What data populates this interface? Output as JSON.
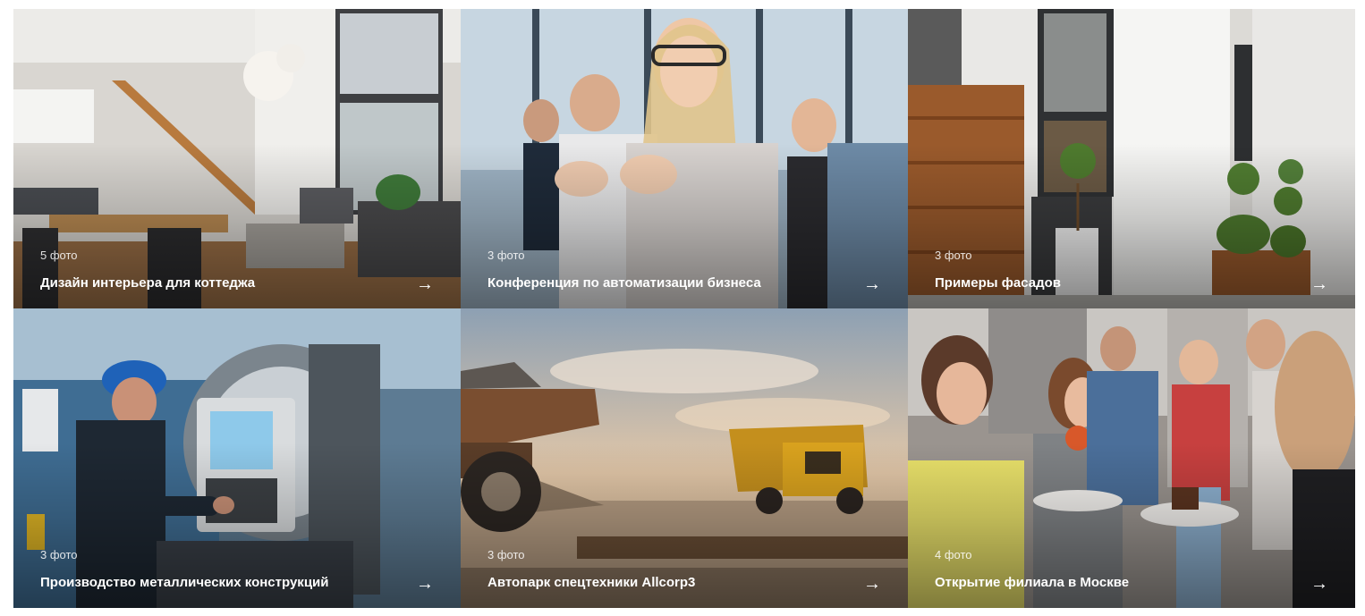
{
  "gallery": {
    "items": [
      {
        "count": "5 фото",
        "title": "Дизайн интерьера для коттеджа",
        "arrow": "→"
      },
      {
        "count": "3 фото",
        "title": "Конференция по автоматизации бизнеса",
        "arrow": "→"
      },
      {
        "count": "3 фото",
        "title": "Примеры фасадов",
        "arrow": "→"
      },
      {
        "count": "3 фото",
        "title": "Производство металлических конструкций",
        "arrow": "→"
      },
      {
        "count": "3 фото",
        "title": "Автопарк спецтехники Allcorp3",
        "arrow": "→"
      },
      {
        "count": "4 фото",
        "title": "Открытие филиала в Москве",
        "arrow": "→"
      }
    ]
  }
}
